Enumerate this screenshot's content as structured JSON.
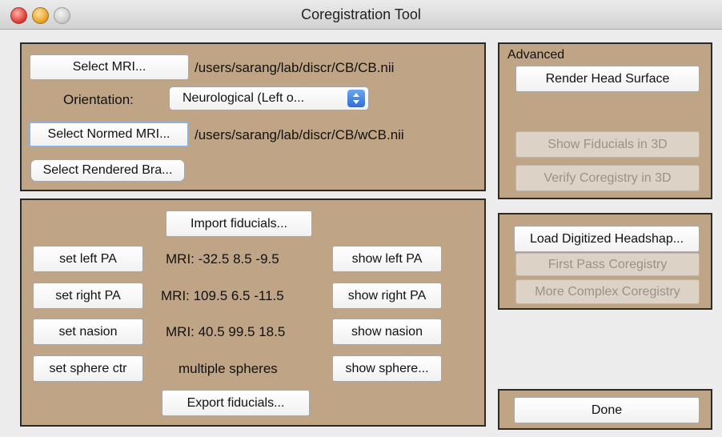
{
  "window": {
    "title": "Coregistration Tool"
  },
  "mri_panel": {
    "select_mri_label": "Select MRI...",
    "mri_path": "/users/sarang/lab/discr/CB/CB.nii",
    "orientation_label": "Orientation:",
    "orientation_value": "Neurological (Left o...",
    "select_normed_label": "Select Normed MRI...",
    "normed_path": "/users/sarang/lab/discr/CB/wCB.nii",
    "select_rendered_label": "Select Rendered Bra..."
  },
  "fiducials_panel": {
    "import_label": "Import fiducials...",
    "export_label": "Export fiducials...",
    "rows": [
      {
        "set_label": "set left PA",
        "value": "MRI: -32.5 8.5 -9.5",
        "show_label": "show left PA"
      },
      {
        "set_label": "set right PA",
        "value": "MRI: 109.5 6.5 -11.5",
        "show_label": "show right PA"
      },
      {
        "set_label": "set nasion",
        "value": "MRI: 40.5 99.5 18.5",
        "show_label": "show nasion"
      },
      {
        "set_label": "set sphere ctr",
        "value": "multiple spheres",
        "show_label": "show sphere..."
      }
    ]
  },
  "advanced_panel": {
    "title": "Advanced",
    "render_label": "Render Head Surface",
    "show_fiducials_label": "Show Fiducials in 3D",
    "verify_label": "Verify Coregistry in 3D"
  },
  "headshape_panel": {
    "load_label": "Load Digitized Headshap...",
    "first_pass_label": "First Pass Coregistry",
    "complex_label": "More Complex Coregistry"
  },
  "done_panel": {
    "done_label": "Done"
  }
}
